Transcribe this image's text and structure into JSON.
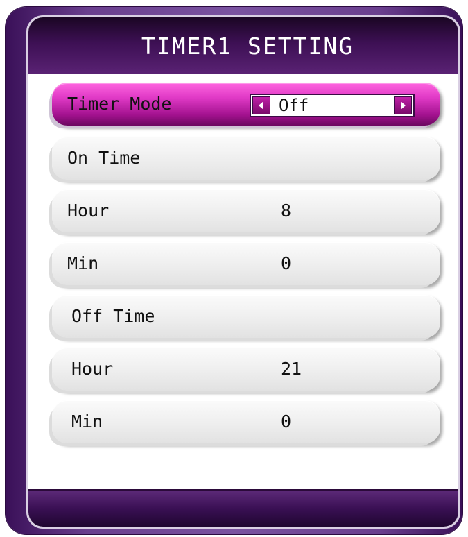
{
  "header": {
    "title": "TIMER1 SETTING"
  },
  "timer_mode": {
    "label": "Timer Mode",
    "value": "Off"
  },
  "rows": [
    {
      "label": "On Time",
      "value": ""
    },
    {
      "label": "Hour",
      "value": "8"
    },
    {
      "label": "Min",
      "value": "0"
    },
    {
      "label": "Off Time",
      "value": ""
    },
    {
      "label": "Hour",
      "value": "21"
    },
    {
      "label": "Min",
      "value": "0"
    }
  ],
  "colors": {
    "accent": "#c020a8",
    "frame": "#6a3f8e",
    "titlebar": "#3d1054"
  },
  "icons": {
    "prev": "arrow-left-icon",
    "next": "arrow-right-icon"
  }
}
